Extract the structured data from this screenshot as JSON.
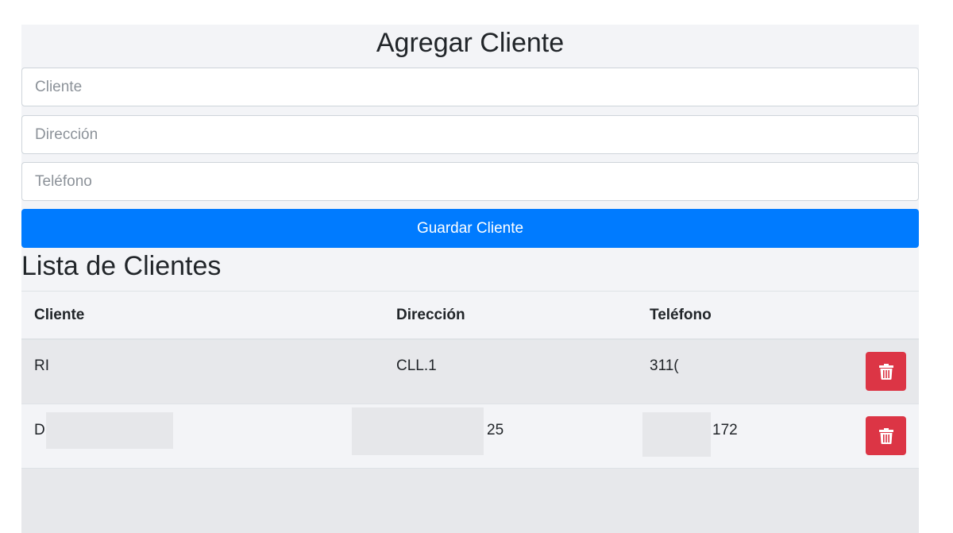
{
  "form": {
    "title": "Agregar Cliente",
    "cliente_placeholder": "Cliente",
    "direccion_placeholder": "Dirección",
    "telefono_placeholder": "Teléfono",
    "save_label": "Guardar Cliente"
  },
  "list": {
    "title": "Lista de Clientes",
    "headers": {
      "cliente": "Cliente",
      "direccion": "Dirección",
      "telefono": "Teléfono"
    },
    "rows": [
      {
        "cliente": "RI",
        "direccion": "CLL.1",
        "telefono": "311("
      },
      {
        "cliente": "Dı",
        "direccion": "25",
        "telefono": "172"
      }
    ],
    "delete_icon": "trash-icon"
  },
  "colors": {
    "primary": "#007bff",
    "danger": "#dc3545",
    "panel_background": "#f3f4f7",
    "striped_row": "#e7e8eb"
  }
}
